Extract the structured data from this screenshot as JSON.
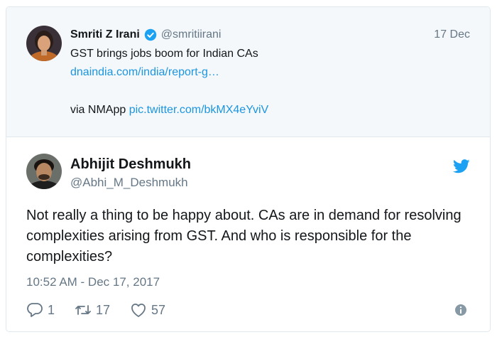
{
  "quoted_tweet": {
    "author_name": "Smriti Z Irani",
    "handle": "@smritiirani",
    "date": "17 Dec",
    "text": "GST brings jobs boom for Indian CAs",
    "link": "dnaindia.com/india/report-g…",
    "via_prefix": "via NMApp ",
    "pic_link": "pic.twitter.com/bkMX4eYviV"
  },
  "reply_tweet": {
    "author_name": "Abhijit Deshmukh",
    "handle": "@Abhi_M_Deshmukh",
    "text": "Not really a thing to be happy about. CAs are in demand for resolving complexities arising from GST. And who is responsible for the complexities?",
    "timestamp": "10:52 AM - Dec 17, 2017",
    "reply_count": "1",
    "retweet_count": "17",
    "like_count": "57"
  },
  "colors": {
    "link": "#1b95e0",
    "secondary_text": "#657786",
    "quoted_background": "#f5f8fa",
    "border": "#e1e8ed"
  },
  "icons": [
    "verified-badge-icon",
    "twitter-bird-icon",
    "reply-icon",
    "retweet-icon",
    "like-icon",
    "info-icon"
  ]
}
